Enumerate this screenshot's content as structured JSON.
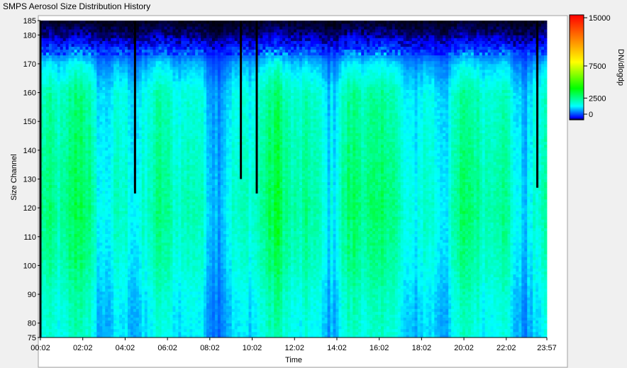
{
  "window": {
    "title": "SMPS Aerosol Size Distribution History"
  },
  "chart_data": {
    "type": "heatmap",
    "title": "SMPS Aerosol Size Distribution History",
    "xlabel": "Time",
    "ylabel": "Size Channel",
    "colorbar_label": "DN/dlogdp",
    "x_ticks": [
      "00:02",
      "02:02",
      "04:02",
      "06:02",
      "08:02",
      "10:02",
      "12:02",
      "14:02",
      "16:02",
      "18:02",
      "20:02",
      "22:02",
      "23:57"
    ],
    "y_ticks": [
      75,
      80,
      90,
      100,
      110,
      120,
      130,
      140,
      150,
      160,
      170,
      180,
      185
    ],
    "ylim": [
      75,
      185
    ],
    "colorbar_ticks": [
      0,
      2500,
      7500,
      15000
    ],
    "colorbar_tick_labels": [
      "0",
      "2500",
      "7500",
      "15000"
    ],
    "colorbar_range": [
      0,
      15000
    ],
    "colorbar_colors": [
      "#000000",
      "#0000ff",
      "#00ffff",
      "#00ff00",
      "#ffff00",
      "#ff0000"
    ],
    "typical_value_by_channel": [
      {
        "channel": 75,
        "value": 1900
      },
      {
        "channel": 90,
        "value": 2100
      },
      {
        "channel": 100,
        "value": 2400
      },
      {
        "channel": 120,
        "value": 2700
      },
      {
        "channel": 140,
        "value": 2500
      },
      {
        "channel": 160,
        "value": 2300
      },
      {
        "channel": 170,
        "value": 1500
      },
      {
        "channel": 176,
        "value": 500
      },
      {
        "channel": 180,
        "value": 150
      },
      {
        "channel": 185,
        "value": 30
      }
    ],
    "gap_lines": [
      {
        "time": "00:02",
        "channel_from": 75,
        "channel_to": 185
      },
      {
        "time": "04:30",
        "channel_from": 125,
        "channel_to": 185
      },
      {
        "time": "09:30",
        "channel_from": 130,
        "channel_to": 185
      },
      {
        "time": "10:15",
        "channel_from": 125,
        "channel_to": 185
      },
      {
        "time": "23:30",
        "channel_from": 127,
        "channel_to": 185
      }
    ]
  }
}
